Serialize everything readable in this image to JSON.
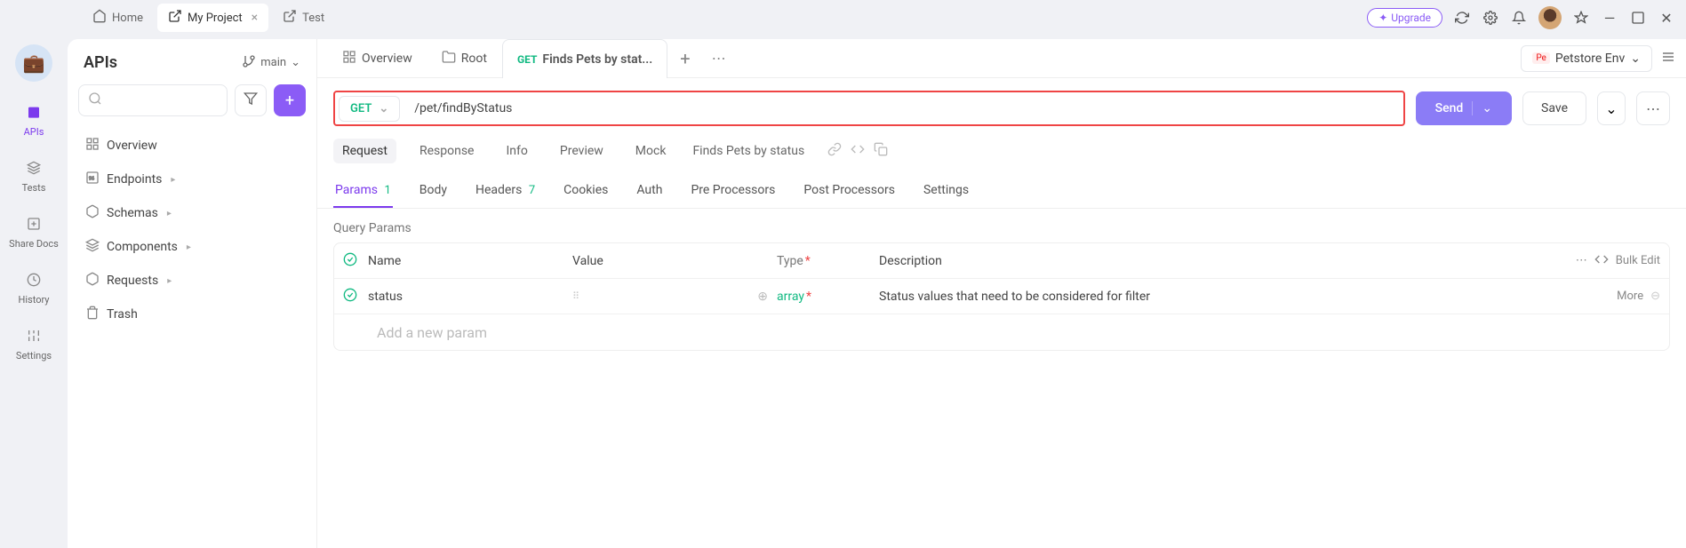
{
  "topbar": {
    "tabs": [
      "Home",
      "My Project",
      "Test"
    ],
    "active_index": 1,
    "upgrade": "Upgrade"
  },
  "farLeft": {
    "items": [
      "APIs",
      "Tests",
      "Share Docs",
      "History",
      "Settings"
    ],
    "active_index": 0
  },
  "sidebar": {
    "title": "APIs",
    "branch": "main",
    "tree": [
      "Overview",
      "Endpoints",
      "Schemas",
      "Components",
      "Requests",
      "Trash"
    ]
  },
  "contentTabs": {
    "items": [
      {
        "label": "Overview",
        "method": ""
      },
      {
        "label": "Root",
        "method": ""
      },
      {
        "label": "Finds Pets by stat...",
        "method": "GET"
      }
    ],
    "active_index": 2
  },
  "env": {
    "label": "Petstore Env",
    "badge": "Pe"
  },
  "url": {
    "method": "GET",
    "path": "/pet/findByStatus"
  },
  "buttons": {
    "send": "Send",
    "save": "Save"
  },
  "subTabs": {
    "items": [
      "Request",
      "Response",
      "Info",
      "Preview",
      "Mock"
    ],
    "active_index": 0,
    "apiName": "Finds Pets by status"
  },
  "paramTabs": {
    "items": [
      {
        "label": "Params",
        "badge": "1"
      },
      {
        "label": "Body",
        "badge": ""
      },
      {
        "label": "Headers",
        "badge": "7"
      },
      {
        "label": "Cookies",
        "badge": ""
      },
      {
        "label": "Auth",
        "badge": ""
      },
      {
        "label": "Pre Processors",
        "badge": ""
      },
      {
        "label": "Post Processors",
        "badge": ""
      },
      {
        "label": "Settings",
        "badge": ""
      }
    ],
    "active_index": 0
  },
  "paramsSection": {
    "label": "Query Params",
    "headers": {
      "name": "Name",
      "value": "Value",
      "type": "Type",
      "desc": "Description",
      "bulk": "Bulk Edit"
    },
    "rows": [
      {
        "name": "status",
        "value": "",
        "type": "array",
        "desc": "Status values that need to be considered for filter",
        "more": "More"
      }
    ],
    "ghost": "Add a new param"
  }
}
